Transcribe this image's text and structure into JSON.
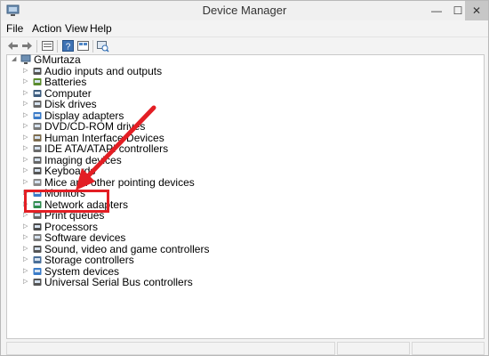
{
  "window": {
    "title": "Device Manager"
  },
  "window_controls": {
    "minimize": "—",
    "maximize": "☐",
    "close": "✕"
  },
  "menu": [
    {
      "label": "File"
    },
    {
      "label": "Action"
    },
    {
      "label": "View"
    },
    {
      "label": "Help"
    }
  ],
  "toolbar": [
    {
      "icon": "back-arrow-icon"
    },
    {
      "icon": "forward-arrow-icon"
    },
    {
      "icon": "properties-icon"
    },
    {
      "icon": "help-icon"
    },
    {
      "icon": "view-icon"
    },
    {
      "icon": "scan-hardware-icon"
    }
  ],
  "tree": {
    "root": {
      "label": "GMurtaza",
      "icon": "computer-icon",
      "expanded": true
    },
    "items": [
      {
        "label": "Audio inputs and outputs",
        "icon": "speaker-icon"
      },
      {
        "label": "Batteries",
        "icon": "battery-icon"
      },
      {
        "label": "Computer",
        "icon": "computer-icon"
      },
      {
        "label": "Disk drives",
        "icon": "disk-icon"
      },
      {
        "label": "Display adapters",
        "icon": "display-icon"
      },
      {
        "label": "DVD/CD-ROM drives",
        "icon": "dvd-icon"
      },
      {
        "label": "Human Interface Devices",
        "icon": "hid-icon"
      },
      {
        "label": "IDE ATA/ATAPI controllers",
        "icon": "ide-icon"
      },
      {
        "label": "Imaging devices",
        "icon": "camera-icon"
      },
      {
        "label": "Keyboards",
        "icon": "keyboard-icon"
      },
      {
        "label": "Mice and other pointing devices",
        "icon": "mouse-icon"
      },
      {
        "label": "Monitors",
        "icon": "monitor-icon"
      },
      {
        "label": "Network adapters",
        "icon": "network-icon"
      },
      {
        "label": "Print queues",
        "icon": "printer-icon"
      },
      {
        "label": "Processors",
        "icon": "processor-icon"
      },
      {
        "label": "Software devices",
        "icon": "software-icon"
      },
      {
        "label": "Sound, video and game controllers",
        "icon": "sound-icon"
      },
      {
        "label": "Storage controllers",
        "icon": "storage-icon"
      },
      {
        "label": "System devices",
        "icon": "system-icon"
      },
      {
        "label": "Universal Serial Bus controllers",
        "icon": "usb-icon"
      }
    ]
  },
  "annotation": {
    "highlight_color": "#e31e24",
    "highlighted_item": "Network adapters"
  },
  "colors": {
    "window_bg": "#f3f3f3",
    "content_bg": "#ffffff",
    "accent": "#e31e24"
  }
}
